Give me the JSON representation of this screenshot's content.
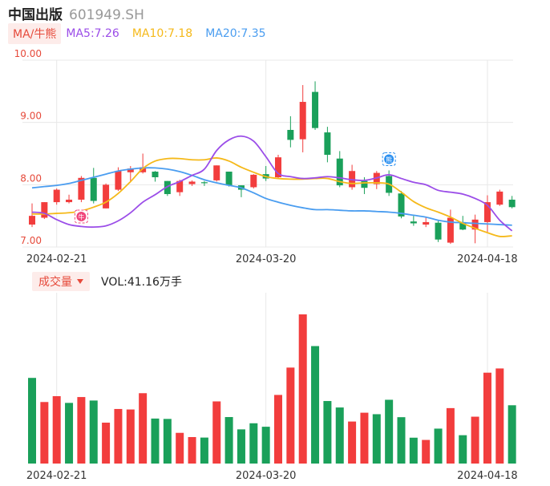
{
  "header": {
    "name": "中国出版",
    "code": "601949.SH"
  },
  "ma_legend": {
    "tag": "MA/牛熊",
    "ma5": "MA5:7.26",
    "ma10": "MA10:7.18",
    "ma20": "MA20:7.35"
  },
  "volume_legend": {
    "tag": "成交量",
    "value": "VOL:41.16万手"
  },
  "markers": {
    "bull": "牛",
    "bear": "熊"
  },
  "colors": {
    "up": "#f23d3d",
    "down": "#1aa05a",
    "ma5": "#9b4de8",
    "ma10": "#f5b91a",
    "ma20": "#4a9df0",
    "axis_red": "#e64a3b",
    "grid": "#e8e8e8"
  },
  "chart_data": [
    {
      "type": "candlestick",
      "ylim": [
        7.0,
        10.0
      ],
      "yticks": [
        "10.00",
        "9.00",
        "8.00",
        "7.00"
      ],
      "xticks": [
        "2024-02-21",
        "2024-03-20",
        "2024-04-18"
      ],
      "xtick_index": [
        2,
        19,
        37
      ],
      "grid": true,
      "candles": [
        {
          "o": 7.36,
          "c": 7.5,
          "h": 7.7,
          "l": 7.32
        },
        {
          "o": 7.47,
          "c": 7.72,
          "h": 7.72,
          "l": 7.45
        },
        {
          "o": 7.72,
          "c": 7.92,
          "h": 7.94,
          "l": 7.68
        },
        {
          "o": 7.72,
          "c": 7.76,
          "h": 7.84,
          "l": 7.7
        },
        {
          "o": 7.76,
          "c": 8.11,
          "h": 8.14,
          "l": 7.72
        },
        {
          "o": 8.11,
          "c": 7.74,
          "h": 8.27,
          "l": 7.7
        },
        {
          "o": 7.62,
          "c": 8.0,
          "h": 8.02,
          "l": 7.62
        },
        {
          "o": 7.92,
          "c": 8.22,
          "h": 8.28,
          "l": 7.9
        },
        {
          "o": 8.2,
          "c": 8.26,
          "h": 8.3,
          "l": 8.05
        },
        {
          "o": 8.2,
          "c": 8.28,
          "h": 8.5,
          "l": 8.18
        },
        {
          "o": 8.21,
          "c": 8.12,
          "h": 8.22,
          "l": 8.05
        },
        {
          "o": 8.06,
          "c": 7.85,
          "h": 8.06,
          "l": 7.82
        },
        {
          "o": 7.88,
          "c": 8.06,
          "h": 8.08,
          "l": 7.82
        },
        {
          "o": 8.01,
          "c": 8.05,
          "h": 8.07,
          "l": 7.98
        },
        {
          "o": 8.04,
          "c": 8.03,
          "h": 8.06,
          "l": 7.98
        },
        {
          "o": 8.07,
          "c": 8.31,
          "h": 8.31,
          "l": 8.05
        },
        {
          "o": 8.21,
          "c": 7.99,
          "h": 8.21,
          "l": 7.97
        },
        {
          "o": 7.99,
          "c": 7.92,
          "h": 7.99,
          "l": 7.8
        },
        {
          "o": 7.96,
          "c": 8.16,
          "h": 8.17,
          "l": 7.94
        },
        {
          "o": 8.17,
          "c": 8.1,
          "h": 8.3,
          "l": 8.06
        },
        {
          "o": 8.12,
          "c": 8.44,
          "h": 8.48,
          "l": 8.1
        },
        {
          "o": 8.88,
          "c": 8.72,
          "h": 9.1,
          "l": 8.6
        },
        {
          "o": 8.73,
          "c": 9.33,
          "h": 9.6,
          "l": 8.52
        },
        {
          "o": 9.49,
          "c": 8.91,
          "h": 9.66,
          "l": 8.88
        },
        {
          "o": 8.84,
          "c": 8.48,
          "h": 8.93,
          "l": 8.36
        },
        {
          "o": 8.42,
          "c": 7.99,
          "h": 8.54,
          "l": 7.96
        },
        {
          "o": 7.96,
          "c": 8.22,
          "h": 8.32,
          "l": 7.92
        },
        {
          "o": 8.06,
          "c": 7.95,
          "h": 8.12,
          "l": 7.85
        },
        {
          "o": 8.01,
          "c": 8.19,
          "h": 8.22,
          "l": 7.93
        },
        {
          "o": 8.14,
          "c": 7.87,
          "h": 8.23,
          "l": 7.82
        },
        {
          "o": 7.86,
          "c": 7.49,
          "h": 7.9,
          "l": 7.46
        },
        {
          "o": 7.41,
          "c": 7.38,
          "h": 7.5,
          "l": 7.34
        },
        {
          "o": 7.36,
          "c": 7.4,
          "h": 7.47,
          "l": 7.32
        },
        {
          "o": 7.39,
          "c": 7.12,
          "h": 7.42,
          "l": 7.08
        },
        {
          "o": 7.07,
          "c": 7.47,
          "h": 7.6,
          "l": 7.05
        },
        {
          "o": 7.4,
          "c": 7.28,
          "h": 7.5,
          "l": 7.27
        },
        {
          "o": 7.28,
          "c": 7.44,
          "h": 7.52,
          "l": 7.06
        },
        {
          "o": 7.4,
          "c": 7.72,
          "h": 7.83,
          "l": 7.24
        },
        {
          "o": 7.68,
          "c": 7.89,
          "h": 7.92,
          "l": 7.66
        },
        {
          "o": 7.76,
          "c": 7.64,
          "h": 7.82,
          "l": 7.62
        }
      ],
      "ma5": [
        7.56,
        7.54,
        7.44,
        7.36,
        7.33,
        7.32,
        7.34,
        7.42,
        7.55,
        7.72,
        7.84,
        7.97,
        8.05,
        8.15,
        8.25,
        8.55,
        8.72,
        8.78,
        8.7,
        8.45,
        8.18,
        8.13,
        8.1,
        8.11,
        8.13,
        8.11,
        8.08,
        8.07,
        8.11,
        8.16,
        8.1,
        8.04,
        8.0,
        7.91,
        7.88,
        7.85,
        7.78,
        7.67,
        7.43,
        7.26
      ],
      "ma10": [
        7.53,
        7.53,
        7.54,
        7.55,
        7.58,
        7.64,
        7.72,
        7.86,
        8.05,
        8.26,
        8.38,
        8.42,
        8.42,
        8.4,
        8.4,
        8.43,
        8.38,
        8.28,
        8.2,
        8.13,
        8.1,
        8.09,
        8.09,
        8.1,
        8.1,
        8.05,
        8.02,
        8.03,
        8.03,
        8.01,
        7.88,
        7.73,
        7.63,
        7.56,
        7.48,
        7.38,
        7.3,
        7.23,
        7.17,
        7.18
      ],
      "ma20": [
        7.95,
        7.97,
        7.99,
        8.02,
        8.07,
        8.12,
        8.17,
        8.22,
        8.25,
        8.27,
        8.27,
        8.25,
        8.21,
        8.15,
        8.08,
        8.03,
        7.99,
        7.95,
        7.87,
        7.78,
        7.72,
        7.67,
        7.63,
        7.6,
        7.6,
        7.59,
        7.58,
        7.58,
        7.57,
        7.56,
        7.54,
        7.51,
        7.48,
        7.43,
        7.4,
        7.39,
        7.38,
        7.37,
        7.36,
        7.35
      ]
    },
    {
      "type": "bar",
      "title": "成交量",
      "xticks": [
        "2024-02-21",
        "2024-03-20",
        "2024-04-18"
      ],
      "xtick_index": [
        2,
        19,
        37
      ],
      "values": [
        68.9,
        49.5,
        54.2,
        48.8,
        53.5,
        50.7,
        32.9,
        43.9,
        43.5,
        56.6,
        36.2,
        35.9,
        24.7,
        21.3,
        20.9,
        50.0,
        37.4,
        27.5,
        32.4,
        29.6,
        55.2,
        77.2,
        120.0,
        94.5,
        50.3,
        45.1,
        33.8,
        40.9,
        39.7,
        51.3,
        37.3,
        20.8,
        19.0,
        28.1,
        44.6,
        22.8,
        37.7,
        73.1,
        76.5,
        46.9
      ],
      "directions": [
        "down",
        "up",
        "up",
        "down",
        "up",
        "down",
        "up",
        "up",
        "up",
        "up",
        "down",
        "down",
        "up",
        "up",
        "down",
        "up",
        "down",
        "down",
        "down",
        "down",
        "up",
        "up",
        "up",
        "down",
        "down",
        "down",
        "up",
        "up",
        "down",
        "down",
        "down",
        "down",
        "up",
        "down",
        "up",
        "down",
        "up",
        "up",
        "up",
        "down"
      ]
    }
  ]
}
